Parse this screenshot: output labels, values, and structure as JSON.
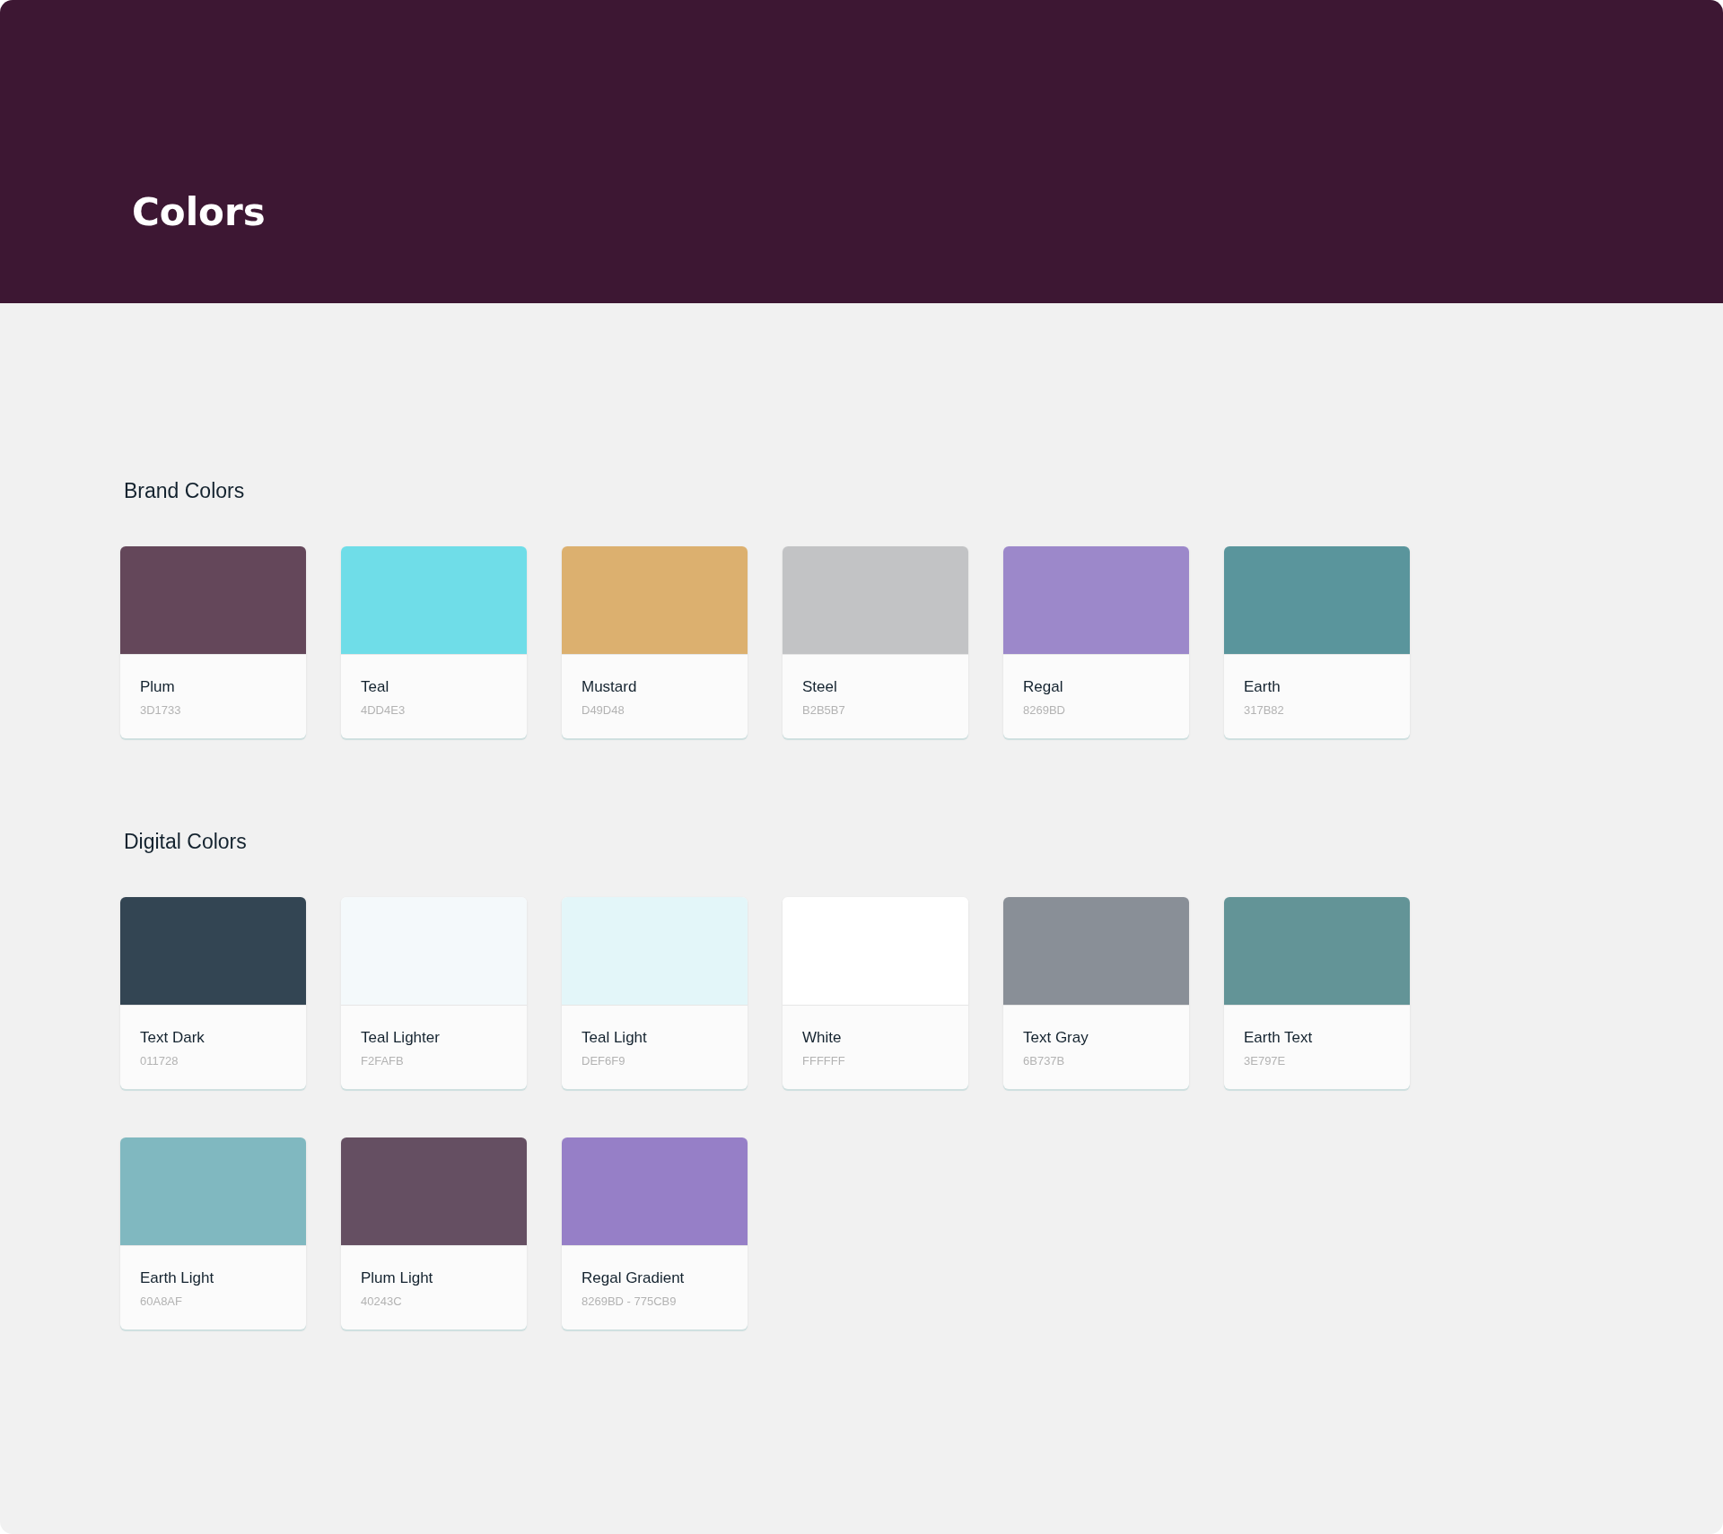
{
  "header": {
    "title": "Colors"
  },
  "sections": [
    {
      "title": "Brand Colors",
      "rows": [
        [
          {
            "name": "Plum",
            "code": "3D1733",
            "color": "#64475a"
          },
          {
            "name": "Teal",
            "code": "4DD4E3",
            "color": "#6fdde8"
          },
          {
            "name": "Mustard",
            "code": "D49D48",
            "color": "#dcb06f"
          },
          {
            "name": "Steel",
            "code": "B2B5B7",
            "color": "#c2c3c5"
          },
          {
            "name": "Regal",
            "code": "8269BD",
            "color": "#9c88ca"
          },
          {
            "name": "Earth",
            "code": "317B82",
            "color": "#5a959c"
          }
        ]
      ]
    },
    {
      "title": "Digital Colors",
      "rows": [
        [
          {
            "name": "Text Dark",
            "code": "011728",
            "color": "#334553"
          },
          {
            "name": "Teal Lighter",
            "code": "F2FAFB",
            "color": "#f4f9fb"
          },
          {
            "name": "Teal Light",
            "code": "DEF6F9",
            "color": "#e3f6f9"
          },
          {
            "name": "White",
            "code": "FFFFFF",
            "color": "#ffffff"
          },
          {
            "name": "Text Gray",
            "code": "6B737B",
            "color": "#898f97"
          },
          {
            "name": "Earth Text",
            "code": "3E797E",
            "color": "#639497"
          }
        ],
        [
          {
            "name": "Earth Light",
            "code": "60A8AF",
            "color": "#80b8c0"
          },
          {
            "name": "Plum Light",
            "code": "40243C",
            "color": "#654f62"
          },
          {
            "name": "Regal Gradient",
            "code": "8269BD - 775CB9",
            "color": "#967fc7"
          }
        ]
      ]
    }
  ]
}
